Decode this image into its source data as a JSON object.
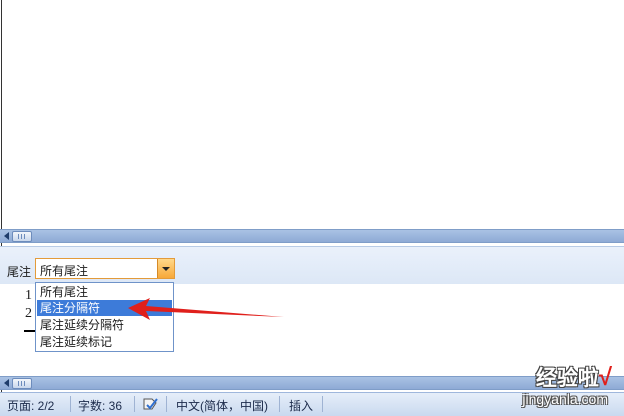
{
  "notes_pane": {
    "label": "尾注",
    "combo_value": "所有尾注",
    "options": [
      "所有尾注",
      "尾注分隔符",
      "尾注延续分隔符",
      "尾注延续标记"
    ],
    "selected_index": 1,
    "note_numbers": [
      "1",
      "2"
    ]
  },
  "status_bar": {
    "page": "页面: 2/2",
    "word_count": "字数: 36",
    "language": "中文(简体，中国)",
    "mode": "插入"
  },
  "watermark": {
    "main": "经验啦",
    "check": "√",
    "sub": "jingyanla.com"
  },
  "colors": {
    "accent_orange": "#f7a83a",
    "selection_blue": "#3d7bd9",
    "scrollbar_blue": "#8eaad5",
    "annotation_red": "#e0201c"
  },
  "icons": [
    "scroll-left-arrow-icon",
    "dropdown-arrow-icon",
    "proofing-icon",
    "red-arrow-annotation"
  ]
}
